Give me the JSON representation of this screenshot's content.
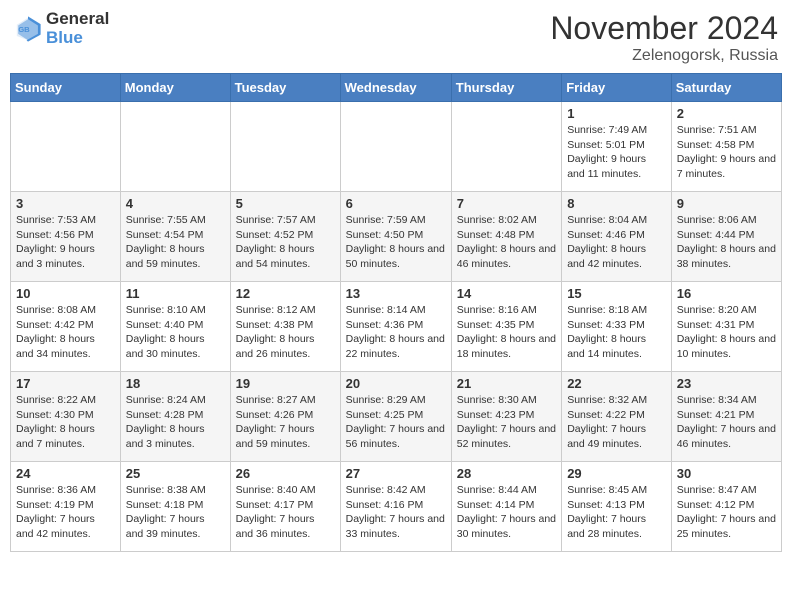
{
  "header": {
    "logo_line1": "General",
    "logo_line2": "Blue",
    "month_title": "November 2024",
    "location": "Zelenogorsk, Russia"
  },
  "weekdays": [
    "Sunday",
    "Monday",
    "Tuesday",
    "Wednesday",
    "Thursday",
    "Friday",
    "Saturday"
  ],
  "weeks": [
    [
      {
        "day": "",
        "sunrise": "",
        "sunset": "",
        "daylight": ""
      },
      {
        "day": "",
        "sunrise": "",
        "sunset": "",
        "daylight": ""
      },
      {
        "day": "",
        "sunrise": "",
        "sunset": "",
        "daylight": ""
      },
      {
        "day": "",
        "sunrise": "",
        "sunset": "",
        "daylight": ""
      },
      {
        "day": "",
        "sunrise": "",
        "sunset": "",
        "daylight": ""
      },
      {
        "day": "1",
        "sunrise": "Sunrise: 7:49 AM",
        "sunset": "Sunset: 5:01 PM",
        "daylight": "Daylight: 9 hours and 11 minutes."
      },
      {
        "day": "2",
        "sunrise": "Sunrise: 7:51 AM",
        "sunset": "Sunset: 4:58 PM",
        "daylight": "Daylight: 9 hours and 7 minutes."
      }
    ],
    [
      {
        "day": "3",
        "sunrise": "Sunrise: 7:53 AM",
        "sunset": "Sunset: 4:56 PM",
        "daylight": "Daylight: 9 hours and 3 minutes."
      },
      {
        "day": "4",
        "sunrise": "Sunrise: 7:55 AM",
        "sunset": "Sunset: 4:54 PM",
        "daylight": "Daylight: 8 hours and 59 minutes."
      },
      {
        "day": "5",
        "sunrise": "Sunrise: 7:57 AM",
        "sunset": "Sunset: 4:52 PM",
        "daylight": "Daylight: 8 hours and 54 minutes."
      },
      {
        "day": "6",
        "sunrise": "Sunrise: 7:59 AM",
        "sunset": "Sunset: 4:50 PM",
        "daylight": "Daylight: 8 hours and 50 minutes."
      },
      {
        "day": "7",
        "sunrise": "Sunrise: 8:02 AM",
        "sunset": "Sunset: 4:48 PM",
        "daylight": "Daylight: 8 hours and 46 minutes."
      },
      {
        "day": "8",
        "sunrise": "Sunrise: 8:04 AM",
        "sunset": "Sunset: 4:46 PM",
        "daylight": "Daylight: 8 hours and 42 minutes."
      },
      {
        "day": "9",
        "sunrise": "Sunrise: 8:06 AM",
        "sunset": "Sunset: 4:44 PM",
        "daylight": "Daylight: 8 hours and 38 minutes."
      }
    ],
    [
      {
        "day": "10",
        "sunrise": "Sunrise: 8:08 AM",
        "sunset": "Sunset: 4:42 PM",
        "daylight": "Daylight: 8 hours and 34 minutes."
      },
      {
        "day": "11",
        "sunrise": "Sunrise: 8:10 AM",
        "sunset": "Sunset: 4:40 PM",
        "daylight": "Daylight: 8 hours and 30 minutes."
      },
      {
        "day": "12",
        "sunrise": "Sunrise: 8:12 AM",
        "sunset": "Sunset: 4:38 PM",
        "daylight": "Daylight: 8 hours and 26 minutes."
      },
      {
        "day": "13",
        "sunrise": "Sunrise: 8:14 AM",
        "sunset": "Sunset: 4:36 PM",
        "daylight": "Daylight: 8 hours and 22 minutes."
      },
      {
        "day": "14",
        "sunrise": "Sunrise: 8:16 AM",
        "sunset": "Sunset: 4:35 PM",
        "daylight": "Daylight: 8 hours and 18 minutes."
      },
      {
        "day": "15",
        "sunrise": "Sunrise: 8:18 AM",
        "sunset": "Sunset: 4:33 PM",
        "daylight": "Daylight: 8 hours and 14 minutes."
      },
      {
        "day": "16",
        "sunrise": "Sunrise: 8:20 AM",
        "sunset": "Sunset: 4:31 PM",
        "daylight": "Daylight: 8 hours and 10 minutes."
      }
    ],
    [
      {
        "day": "17",
        "sunrise": "Sunrise: 8:22 AM",
        "sunset": "Sunset: 4:30 PM",
        "daylight": "Daylight: 8 hours and 7 minutes."
      },
      {
        "day": "18",
        "sunrise": "Sunrise: 8:24 AM",
        "sunset": "Sunset: 4:28 PM",
        "daylight": "Daylight: 8 hours and 3 minutes."
      },
      {
        "day": "19",
        "sunrise": "Sunrise: 8:27 AM",
        "sunset": "Sunset: 4:26 PM",
        "daylight": "Daylight: 7 hours and 59 minutes."
      },
      {
        "day": "20",
        "sunrise": "Sunrise: 8:29 AM",
        "sunset": "Sunset: 4:25 PM",
        "daylight": "Daylight: 7 hours and 56 minutes."
      },
      {
        "day": "21",
        "sunrise": "Sunrise: 8:30 AM",
        "sunset": "Sunset: 4:23 PM",
        "daylight": "Daylight: 7 hours and 52 minutes."
      },
      {
        "day": "22",
        "sunrise": "Sunrise: 8:32 AM",
        "sunset": "Sunset: 4:22 PM",
        "daylight": "Daylight: 7 hours and 49 minutes."
      },
      {
        "day": "23",
        "sunrise": "Sunrise: 8:34 AM",
        "sunset": "Sunset: 4:21 PM",
        "daylight": "Daylight: 7 hours and 46 minutes."
      }
    ],
    [
      {
        "day": "24",
        "sunrise": "Sunrise: 8:36 AM",
        "sunset": "Sunset: 4:19 PM",
        "daylight": "Daylight: 7 hours and 42 minutes."
      },
      {
        "day": "25",
        "sunrise": "Sunrise: 8:38 AM",
        "sunset": "Sunset: 4:18 PM",
        "daylight": "Daylight: 7 hours and 39 minutes."
      },
      {
        "day": "26",
        "sunrise": "Sunrise: 8:40 AM",
        "sunset": "Sunset: 4:17 PM",
        "daylight": "Daylight: 7 hours and 36 minutes."
      },
      {
        "day": "27",
        "sunrise": "Sunrise: 8:42 AM",
        "sunset": "Sunset: 4:16 PM",
        "daylight": "Daylight: 7 hours and 33 minutes."
      },
      {
        "day": "28",
        "sunrise": "Sunrise: 8:44 AM",
        "sunset": "Sunset: 4:14 PM",
        "daylight": "Daylight: 7 hours and 30 minutes."
      },
      {
        "day": "29",
        "sunrise": "Sunrise: 8:45 AM",
        "sunset": "Sunset: 4:13 PM",
        "daylight": "Daylight: 7 hours and 28 minutes."
      },
      {
        "day": "30",
        "sunrise": "Sunrise: 8:47 AM",
        "sunset": "Sunset: 4:12 PM",
        "daylight": "Daylight: 7 hours and 25 minutes."
      }
    ]
  ]
}
